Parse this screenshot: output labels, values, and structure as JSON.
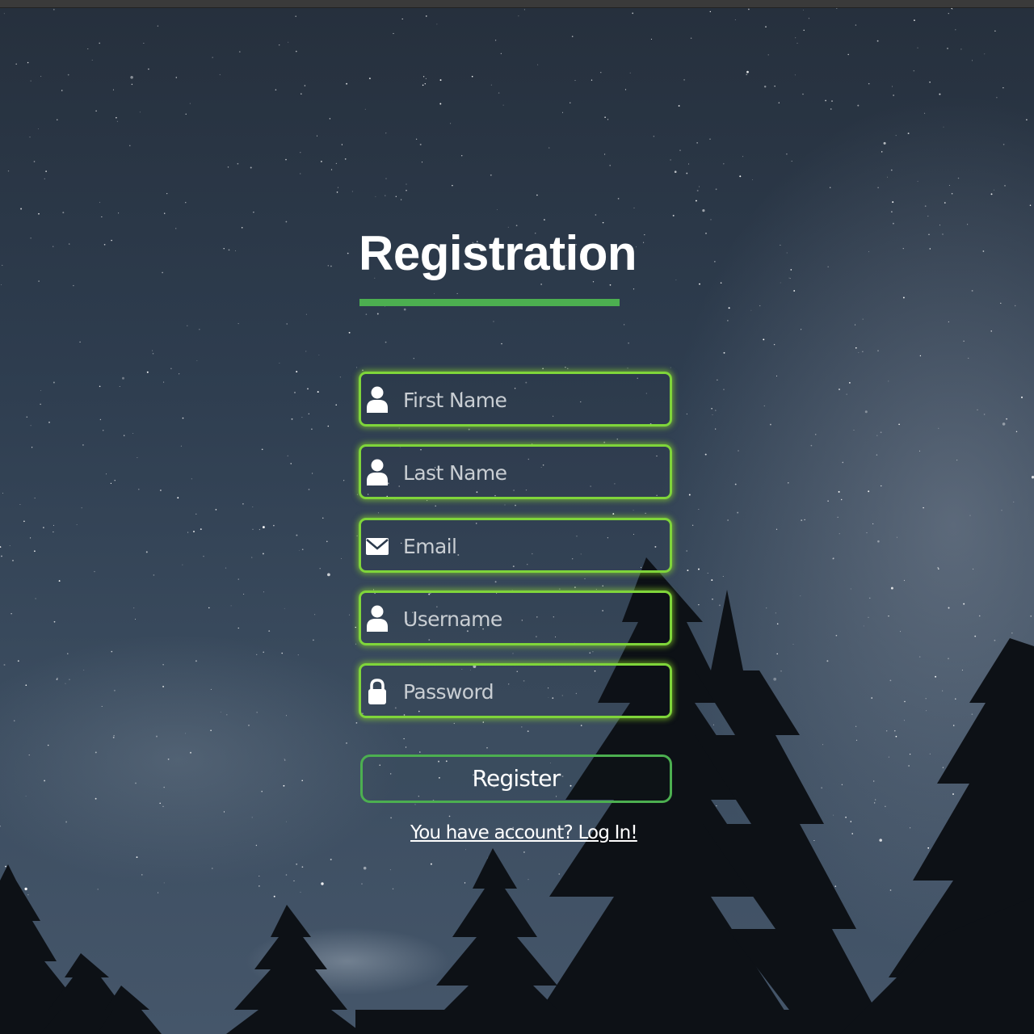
{
  "form": {
    "title": "Registration",
    "fields": [
      {
        "placeholder": "First Name",
        "icon": "user-icon"
      },
      {
        "placeholder": "Last Name",
        "icon": "user-icon"
      },
      {
        "placeholder": "Email",
        "icon": "envelope-icon"
      },
      {
        "placeholder": "Username",
        "icon": "user-icon"
      },
      {
        "placeholder": "Password",
        "icon": "lock-icon"
      }
    ],
    "register_label": "Register",
    "login_link": "You have account? Log In!"
  },
  "colors": {
    "accent": "#4caf50",
    "field_border": "#7fd53a",
    "text": "#ffffff"
  }
}
